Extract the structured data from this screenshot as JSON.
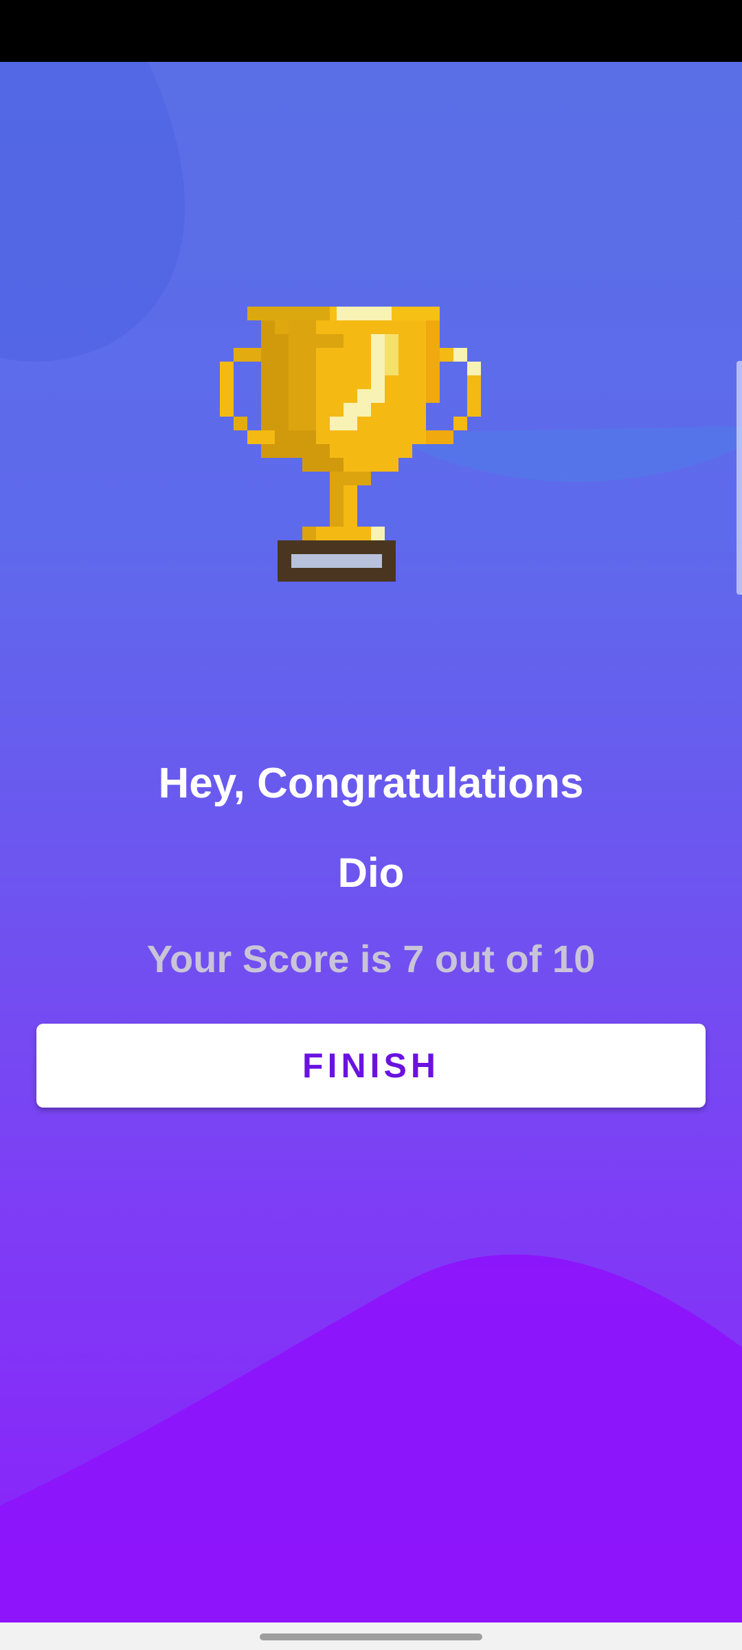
{
  "result": {
    "headline": "Hey, Congratulations",
    "player_name": "Dio",
    "score_text": "Your Score is 7 out of 10"
  },
  "actions": {
    "finish_label": "FINISH"
  },
  "icons": {
    "trophy": "trophy-icon"
  },
  "colors": {
    "background_top": "#5a6fe6",
    "background_bottom": "#8b1ffb",
    "button_text": "#6a12e0",
    "score_text": "#c9c4d8"
  }
}
